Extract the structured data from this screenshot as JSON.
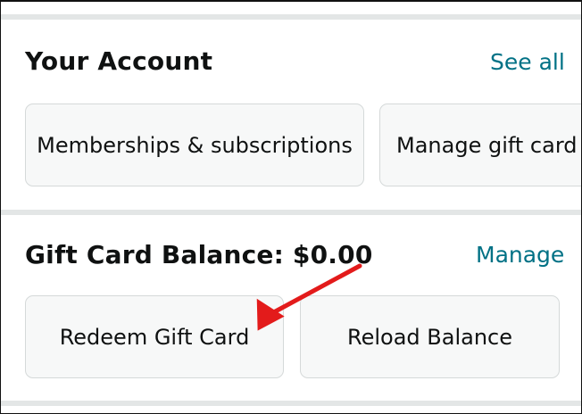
{
  "account": {
    "title": "Your Account",
    "see_all": "See all",
    "chips": [
      "Memberships & subscriptions",
      "Manage gift card balance"
    ]
  },
  "gift_card": {
    "title": "Gift Card Balance: $0.00",
    "manage": "Manage",
    "redeem": "Redeem Gift Card",
    "reload": "Reload Balance"
  },
  "colors": {
    "link": "#007185",
    "divider": "#e3e6e6",
    "chip_border": "#d5d9d9",
    "chip_bg": "#f7f8f8",
    "arrow": "#e31b1b"
  }
}
